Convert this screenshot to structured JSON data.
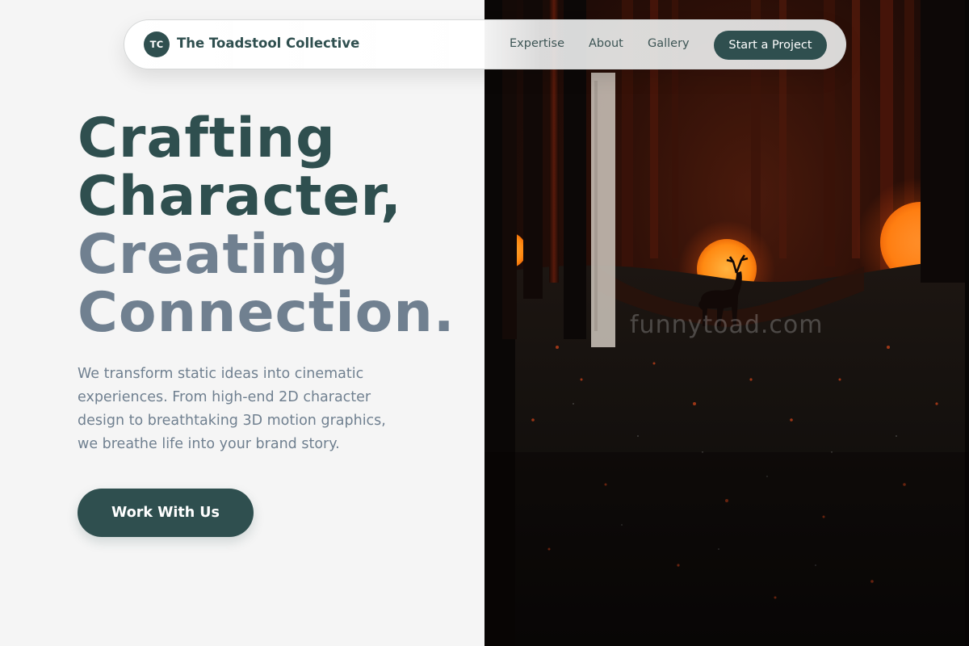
{
  "brand": {
    "initials": "TC",
    "name": "The Toadstool Collective"
  },
  "nav": {
    "links": [
      "Expertise",
      "About",
      "Gallery"
    ],
    "cta_label": "Start a Project"
  },
  "hero": {
    "title_lines": [
      "Crafting",
      "Character,",
      "Creating",
      "Connection."
    ],
    "description": "We transform static ideas into cinematic experiences. From high-end 2D character design to breathtaking 3D motion graphics, we breathe life into your brand story.",
    "cta_label": "Work With Us"
  },
  "image": {
    "watermark": "funnytoad.com",
    "subject": "deer-silhouette-in-dark-forest"
  },
  "colors": {
    "primary": "#2f4f4f",
    "secondary": "#708090",
    "background": "#f5f5f5",
    "glow": "#ff8c1a"
  }
}
